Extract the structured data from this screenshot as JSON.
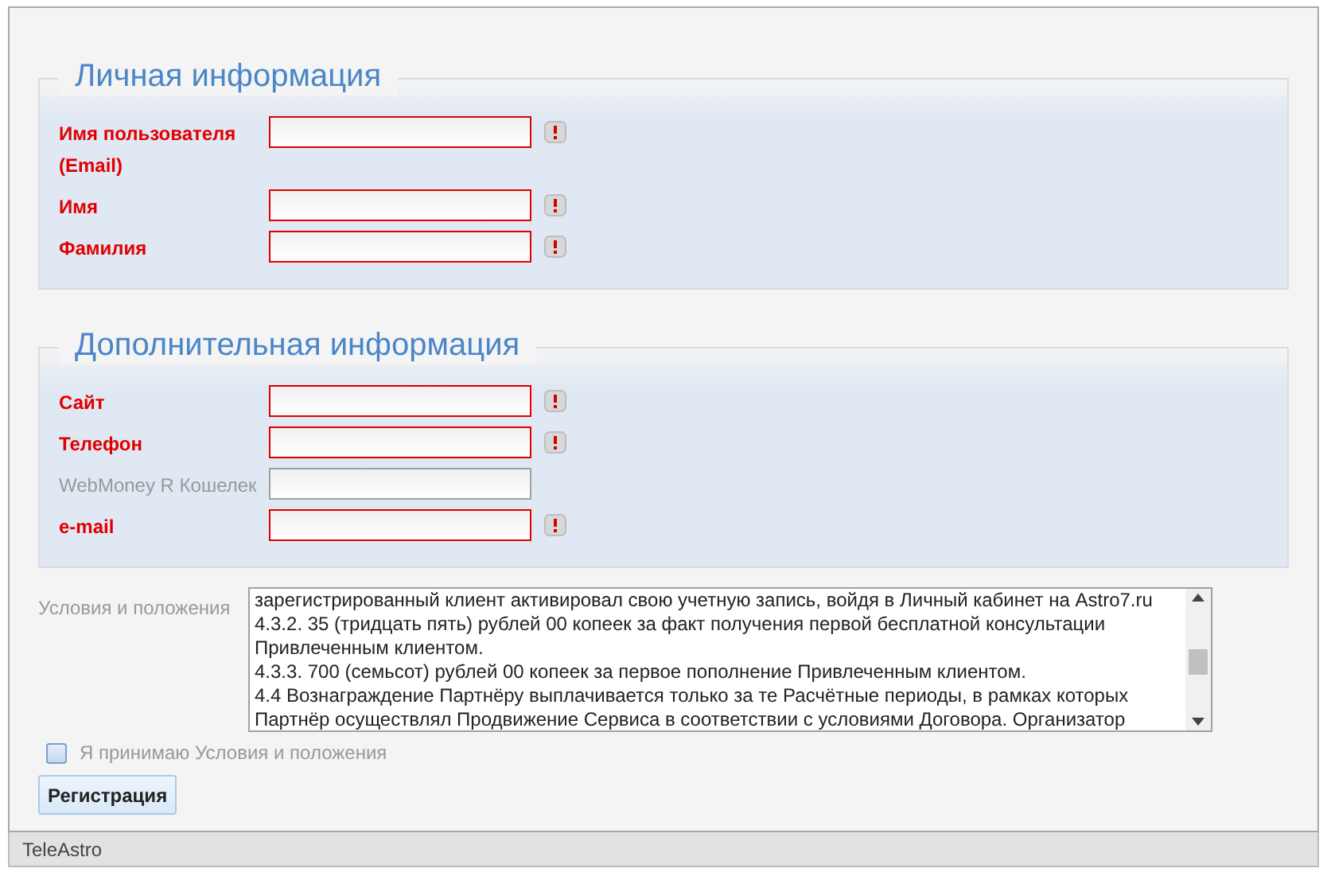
{
  "sections": [
    {
      "legend": "Личная информация",
      "fields": [
        {
          "label": "Имя пользователя (Email)",
          "required": true
        },
        {
          "label": "Имя",
          "required": true
        },
        {
          "label": "Фамилия",
          "required": true
        }
      ]
    },
    {
      "legend": "Дополнительная информация",
      "fields": [
        {
          "label": "Сайт",
          "required": true
        },
        {
          "label": "Телефон",
          "required": true
        },
        {
          "label": "WebMoney R Кошелек",
          "required": false
        },
        {
          "label": "e-mail",
          "required": true
        }
      ]
    }
  ],
  "terms": {
    "label": "Условия и положения",
    "lines": [
      "зарегистрированный клиент активировал свою учетную запись, войдя в Личный кабинет на Astro7.ru",
      "4.3.2. 35 (тридцать пять) рублей 00 копеек за факт получения первой бесплатной консультации Привлеченным клиентом.",
      "4.3.3.  700 (семьсот) рублей 00 копеек за первое пополнение Привлеченным клиентом.",
      "4.4 Вознаграждение Партнёру выплачивается только за те Расчётные периоды, в рамках которых Партнёр осуществлял Продвижение Сервиса в соответствии с условиями Договора. Организатор"
    ]
  },
  "accept": {
    "label": "Я принимаю Условия и положения",
    "checked": false
  },
  "submit": "Регистрация",
  "status_bar": "TeleAstro"
}
